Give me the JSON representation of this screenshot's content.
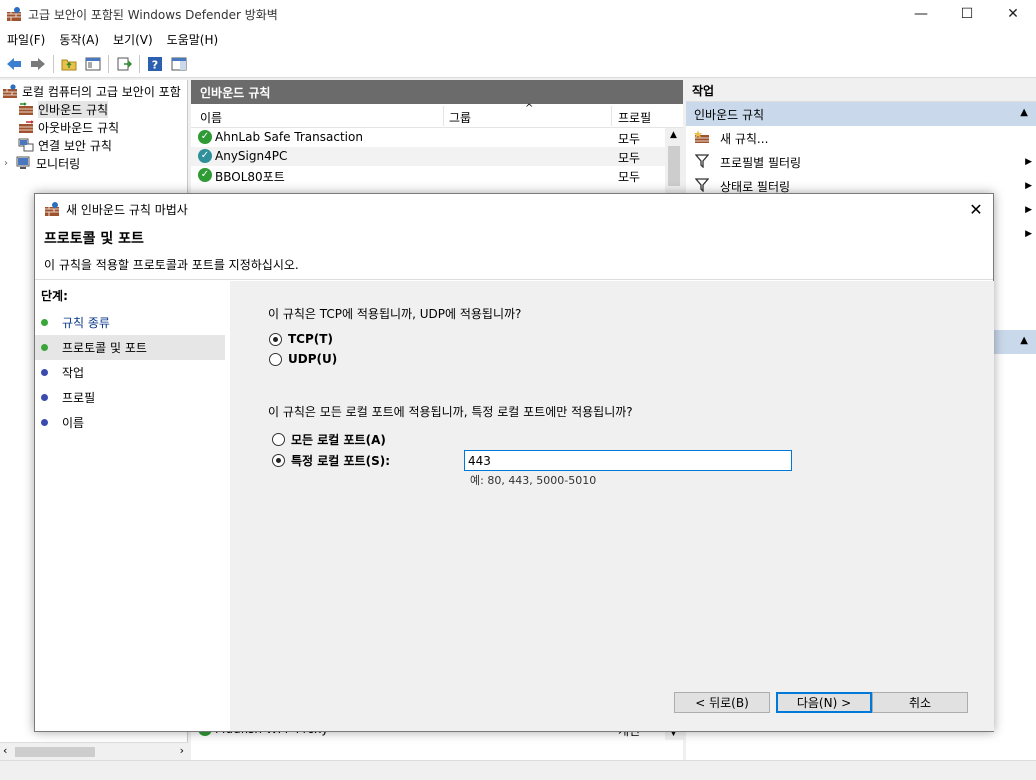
{
  "window": {
    "title": "고급 보안이 포함된 Windows Defender 방화벽",
    "minimize": "—",
    "maximize": "☐",
    "close": "✕"
  },
  "menu": [
    "파일(F)",
    "동작(A)",
    "보기(V)",
    "도움말(H)"
  ],
  "tree": {
    "items": [
      {
        "label": "로컬 컴퓨터의 고급 보안이 포함",
        "indent": 0
      },
      {
        "label": "인바운드 규칙",
        "indent": 1,
        "selected": true
      },
      {
        "label": "아웃바운드 규칙",
        "indent": 1
      },
      {
        "label": "연결 보안 규칙",
        "indent": 1
      },
      {
        "label": "모니터링",
        "indent": 1
      }
    ]
  },
  "center": {
    "header": "인바운드 규칙",
    "columns": {
      "name": "이름",
      "group": "그룹",
      "profile": "프로필"
    },
    "rows": [
      {
        "name": "AhnLab Safe Transaction",
        "profile": "모두"
      },
      {
        "name": "AnySign4PC",
        "profile": "모두"
      },
      {
        "name": "BBOL80포트",
        "profile": "모두"
      }
    ],
    "bottom_row": {
      "name": "Mudfish WFP Proxy",
      "profile": "개인"
    }
  },
  "actions": {
    "header": "작업",
    "section": "인바운드 규칙",
    "items": [
      {
        "label": "새 규칙...",
        "icon": "new-rule-icon",
        "arrow": false
      },
      {
        "label": "프로필별 필터링",
        "icon": "filter-icon",
        "arrow": true
      },
      {
        "label": "상태로 필터링",
        "icon": "filter-icon",
        "arrow": true
      }
    ]
  },
  "dialog": {
    "title": "새 인바운드 규칙 마법사",
    "heading": "프로토콜 및 포트",
    "subheading": "이 규칙을 적용할 프로토콜과 포트를 지정하십시오.",
    "steps_label": "단계:",
    "steps": [
      {
        "label": "규칙 종류",
        "done": true
      },
      {
        "label": "프로토콜 및 포트",
        "done": true,
        "current": true
      },
      {
        "label": "작업",
        "done": false
      },
      {
        "label": "프로필",
        "done": false
      },
      {
        "label": "이름",
        "done": false
      }
    ],
    "question1": "이 규칙은 TCP에 적용됩니까, UDP에 적용됩니까?",
    "tcp_label": "TCP(T)",
    "udp_label": "UDP(U)",
    "protocol_selected": "TCP",
    "question2": "이 규칙은 모든 로컬 포트에 적용됩니까, 특정 로컬 포트에만 적용됩니까?",
    "all_ports_label": "모든 로컬 포트(A)",
    "specific_ports_label": "특정 로컬 포트(S):",
    "ports_selected": "specific",
    "ports_value": "443",
    "ports_hint": "예: 80, 443, 5000-5010",
    "back_label": "< 뒤로(B)",
    "next_label": "다음(N) >",
    "cancel_label": "취소"
  },
  "colors": {
    "accent": "#0078d7",
    "pane_header": "#6b6b6b",
    "action_section": "#c9d8ea",
    "step_done": "#3aa63a",
    "step_todo": "#3a4bb0"
  }
}
